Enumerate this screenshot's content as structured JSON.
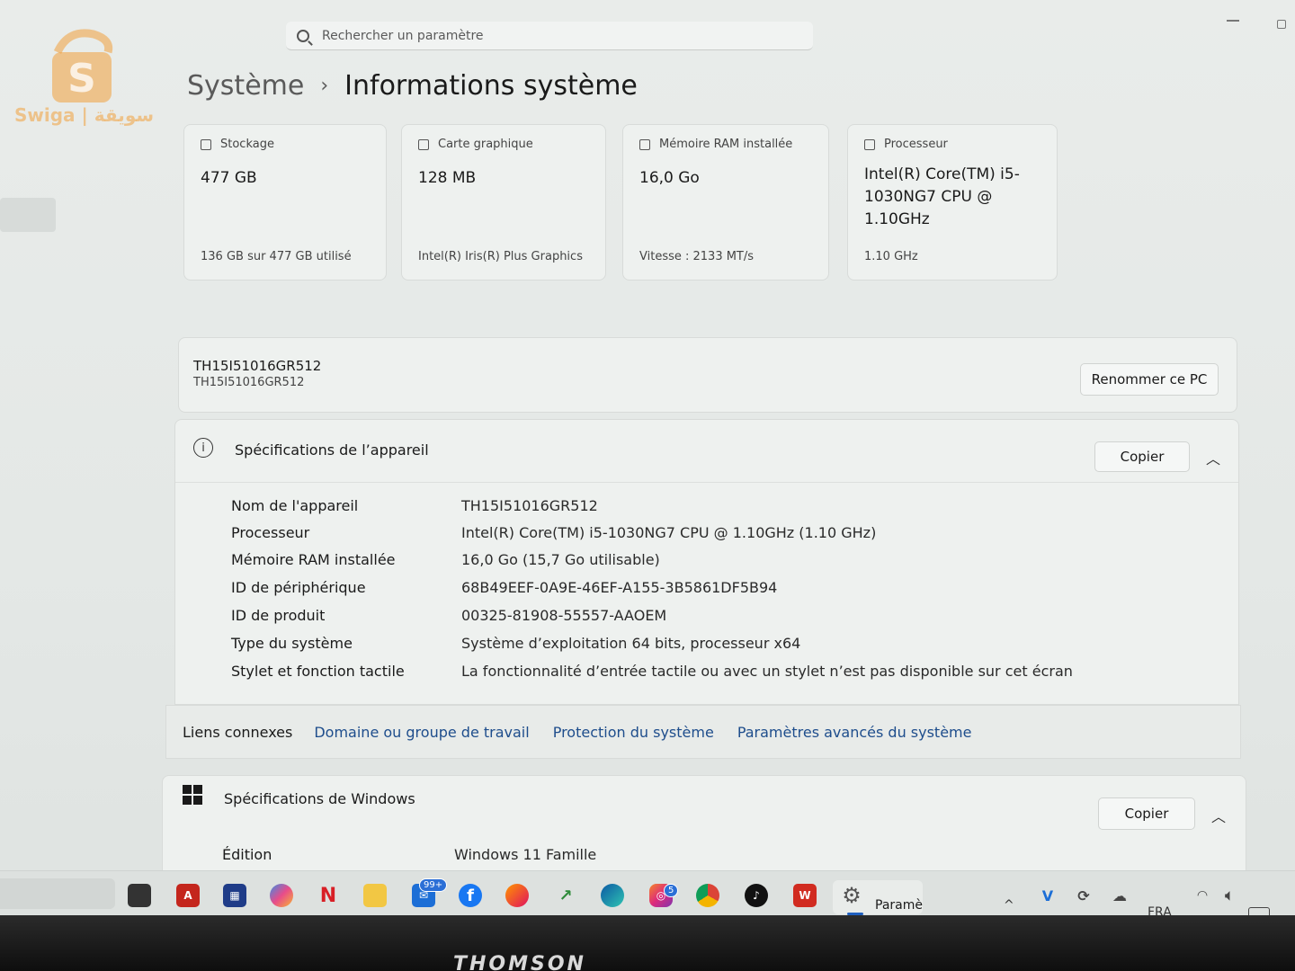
{
  "watermark": {
    "text": "Swiga | سويقة"
  },
  "search": {
    "placeholder": "Rechercher un paramètre"
  },
  "breadcrumb": {
    "parent": "Système",
    "separator": "›",
    "current": "Informations système"
  },
  "cards": [
    {
      "title": "Stockage",
      "value": "477 GB",
      "footer": "136 GB sur 477 GB utilisé"
    },
    {
      "title": "Carte graphique",
      "value": "128 MB",
      "footer": "Intel(R) Iris(R) Plus Graphics"
    },
    {
      "title": "Mémoire RAM installée",
      "value": "16,0 Go",
      "footer": "Vitesse : 2133 MT/s"
    },
    {
      "title": "Processeur",
      "value": "Intel(R) Core(TM) i5-1030NG7 CPU @ 1.10GHz",
      "footer": "1.10 GHz"
    }
  ],
  "pc": {
    "name": "TH15I51016GR512",
    "subtitle": "TH15I51016GR512",
    "rename_label": "Renommer ce PC"
  },
  "device_specs": {
    "title": "Spécifications de l’appareil",
    "copy_label": "Copier",
    "rows": [
      {
        "label": "Nom de l'appareil",
        "value": "TH15I51016GR512"
      },
      {
        "label": "Processeur",
        "value": "Intel(R) Core(TM) i5-1030NG7 CPU @ 1.10GHz (1.10 GHz)"
      },
      {
        "label": "Mémoire RAM installée",
        "value": "16,0 Go (15,7 Go utilisable)"
      },
      {
        "label": "ID de périphérique",
        "value": "68B49EEF-0A9E-46EF-A155-3B5861DF5B94"
      },
      {
        "label": "ID de produit",
        "value": "00325-81908-55557-AAOEM"
      },
      {
        "label": "Type du système",
        "value": "Système d’exploitation 64 bits, processeur x64"
      },
      {
        "label": "Stylet et fonction tactile",
        "value": "La fonctionnalité d’entrée tactile ou avec un stylet n’est pas disponible sur cet écran"
      }
    ]
  },
  "related_links": {
    "label": "Liens connexes",
    "links": [
      "Domaine ou groupe de travail",
      "Protection du système",
      "Paramètres avancés du système"
    ]
  },
  "windows_specs": {
    "title": "Spécifications de Windows",
    "copy_label": "Copier",
    "edition_label": "Édition",
    "edition_value": "Windows 11 Famille"
  },
  "taskbar": {
    "mail_badge": "99+",
    "instagram_badge": "5",
    "active_app_label": "Paramè",
    "language": "FRA"
  },
  "device_brand": "THOMSON"
}
